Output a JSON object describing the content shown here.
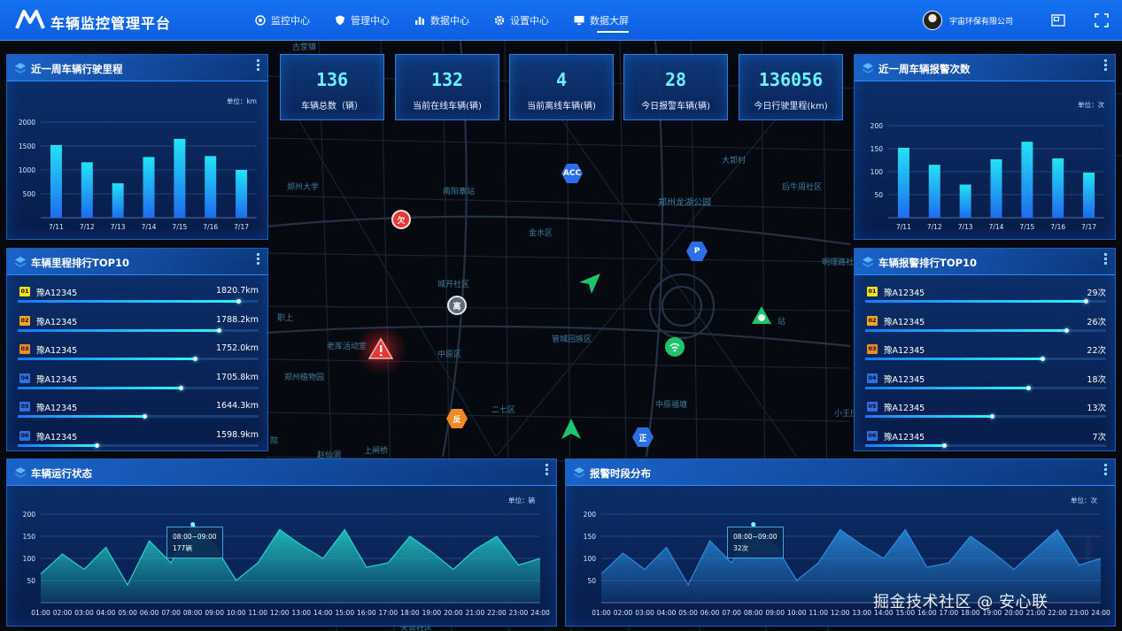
{
  "header": {
    "title": "车辆监控管理平台",
    "company": "宇宙环保有限公司",
    "nav": [
      {
        "label": "监控中心",
        "icon": "monitor-eye-icon"
      },
      {
        "label": "管理中心",
        "icon": "shield-icon"
      },
      {
        "label": "数据中心",
        "icon": "bar-chart-icon"
      },
      {
        "label": "设置中心",
        "icon": "gear-icon"
      },
      {
        "label": "数据大屏",
        "icon": "display-icon",
        "active": true
      }
    ]
  },
  "stats": [
    {
      "value": "136",
      "label": "车辆总数（辆）"
    },
    {
      "value": "132",
      "label": "当前在线车辆(辆)"
    },
    {
      "value": "4",
      "label": "当前离线车辆(辆)"
    },
    {
      "value": "28",
      "label": "今日报警车辆(辆)"
    },
    {
      "value": "136056",
      "label": "今日行驶里程(km)"
    }
  ],
  "panels": {
    "mileage_week": {
      "title": "近一周车辆行驶里程",
      "unit": "单位：km"
    },
    "alarm_week": {
      "title": "近一周车辆报警次数",
      "unit": "单位：次"
    },
    "mileage_top": {
      "title": "车辆里程排行TOP10"
    },
    "alarm_top": {
      "title": "车辆报警排行TOP10"
    },
    "run_status": {
      "title": "车辆运行状态",
      "unit": "单位：辆",
      "tooltip_time": "08:00~09:00",
      "tooltip_value": "177辆"
    },
    "alarm_period": {
      "title": "报警时段分布",
      "unit": "单位：次",
      "tooltip_time": "08:00~09:00",
      "tooltip_value": "32次"
    }
  },
  "mileage_top": [
    {
      "rank": "01",
      "plate": "豫A12345",
      "value": "1820.7km",
      "ratio": 0.92
    },
    {
      "rank": "02",
      "plate": "豫A12345",
      "value": "1788.2km",
      "ratio": 0.84
    },
    {
      "rank": "03",
      "plate": "豫A12345",
      "value": "1752.0km",
      "ratio": 0.74
    },
    {
      "rank": "04",
      "plate": "豫A12345",
      "value": "1705.8km",
      "ratio": 0.68
    },
    {
      "rank": "05",
      "plate": "豫A12345",
      "value": "1644.3km",
      "ratio": 0.53
    },
    {
      "rank": "06",
      "plate": "豫A12345",
      "value": "1598.9km",
      "ratio": 0.33
    }
  ],
  "alarm_top": [
    {
      "rank": "01",
      "plate": "豫A12345",
      "value": "29次",
      "ratio": 0.92
    },
    {
      "rank": "02",
      "plate": "豫A12345",
      "value": "26次",
      "ratio": 0.84
    },
    {
      "rank": "03",
      "plate": "豫A12345",
      "value": "22次",
      "ratio": 0.74
    },
    {
      "rank": "04",
      "plate": "豫A12345",
      "value": "18次",
      "ratio": 0.68
    },
    {
      "rank": "05",
      "plate": "豫A12345",
      "value": "13次",
      "ratio": 0.53
    },
    {
      "rank": "06",
      "plate": "豫A12345",
      "value": "7次",
      "ratio": 0.33
    }
  ],
  "rank_colors": [
    "#f5e11b",
    "#f5a623",
    "#f08a24",
    "#2e6fe8",
    "#2e6fe8",
    "#2e6fe8"
  ],
  "map_labels": [
    "古荥镇",
    "郑州大学",
    "南阳寨站",
    "大郭村",
    "后牛周社区",
    "郑州龙湖公园",
    "金水区",
    "明理路社",
    "城开社区",
    "职上",
    "老库活动室",
    "中原区",
    "管城回族区",
    "站",
    "郑州植物园",
    "中原福塘",
    "二七区",
    "小王庄",
    "院",
    "赵仙洞",
    "上闸桥",
    "大营社区"
  ],
  "map_markers": [
    {
      "type": "hex",
      "text": "ACC",
      "color": "#2a6ee8",
      "name": "acc-marker"
    },
    {
      "type": "circle",
      "text": "欠",
      "color": "#e53935",
      "name": "arrears-marker"
    },
    {
      "type": "hex",
      "text": "P",
      "color": "#2a6ee8",
      "name": "parking-marker"
    },
    {
      "type": "circle",
      "text": "离",
      "color": "#5f6b7a",
      "name": "offline-marker"
    },
    {
      "type": "hex",
      "text": "反",
      "color": "#f08a24",
      "name": "reverse-marker"
    },
    {
      "type": "hex",
      "text": "正",
      "color": "#2a6ee8",
      "name": "forward-marker"
    }
  ],
  "watermark": "掘金技术社区 @ 安心联",
  "chart_data": [
    {
      "type": "bar",
      "title": "近一周车辆行驶里程",
      "categories": [
        "7/11",
        "7/12",
        "7/13",
        "7/14",
        "7/15",
        "7/16",
        "7/17"
      ],
      "values": [
        1520,
        1160,
        720,
        1270,
        1650,
        1290,
        1000
      ],
      "ylim": [
        0,
        2000
      ],
      "yticks": [
        "500",
        "1000",
        "1500",
        "2000"
      ],
      "ylabel": "单位：km",
      "grid": true,
      "color_top": "#22e3f5",
      "color_bottom": "#1e6cf0"
    },
    {
      "type": "bar",
      "title": "近一周车辆报警次数",
      "categories": [
        "7/11",
        "7/12",
        "7/13",
        "7/14",
        "7/15",
        "7/16",
        "7/17"
      ],
      "values": [
        152,
        115,
        72,
        127,
        165,
        129,
        98
      ],
      "ylim": [
        0,
        200
      ],
      "yticks": [
        "50",
        "100",
        "150",
        "200"
      ],
      "ylabel": "单位：次",
      "grid": true,
      "color_top": "#22e3f5",
      "color_bottom": "#1e6cf0"
    },
    {
      "type": "area",
      "title": "车辆运行状态",
      "x": [
        "01:00",
        "02:00",
        "03:00",
        "04:00",
        "05:00",
        "06:00",
        "07:00",
        "08:00",
        "09:00",
        "10:00",
        "11:00",
        "12:00",
        "13:00",
        "14:00",
        "15:00",
        "16:00",
        "17:00",
        "18:00",
        "19:00",
        "20:00",
        "21:00",
        "22:00",
        "23:00",
        "24:00"
      ],
      "values": [
        65,
        110,
        75,
        125,
        40,
        140,
        90,
        177,
        130,
        50,
        90,
        165,
        130,
        100,
        165,
        80,
        90,
        150,
        115,
        75,
        120,
        150,
        85,
        100
      ],
      "ylim": [
        0,
        200
      ],
      "yticks": [
        "50",
        "100",
        "150",
        "200"
      ],
      "ylabel": "单位：辆",
      "grid": true,
      "color": "#24d6c9"
    },
    {
      "type": "area",
      "title": "报警时段分布",
      "x": [
        "01:00",
        "02:00",
        "03:00",
        "04:00",
        "05:00",
        "06:00",
        "07:00",
        "08:00",
        "09:00",
        "10:00",
        "11:00",
        "12:00",
        "13:00",
        "14:00",
        "15:00",
        "16:00",
        "17:00",
        "18:00",
        "19:00",
        "20:00",
        "21:00",
        "22:00",
        "23:00",
        "24:00"
      ],
      "values": [
        65,
        112,
        75,
        125,
        40,
        140,
        90,
        177,
        130,
        50,
        90,
        165,
        130,
        100,
        165,
        80,
        90,
        150,
        115,
        75,
        120,
        165,
        85,
        100
      ],
      "ylim": [
        0,
        200
      ],
      "yticks": [
        "50",
        "100",
        "150",
        "200"
      ],
      "ylabel": "单位：次",
      "grid": true,
      "color": "#2a8ee0"
    }
  ]
}
